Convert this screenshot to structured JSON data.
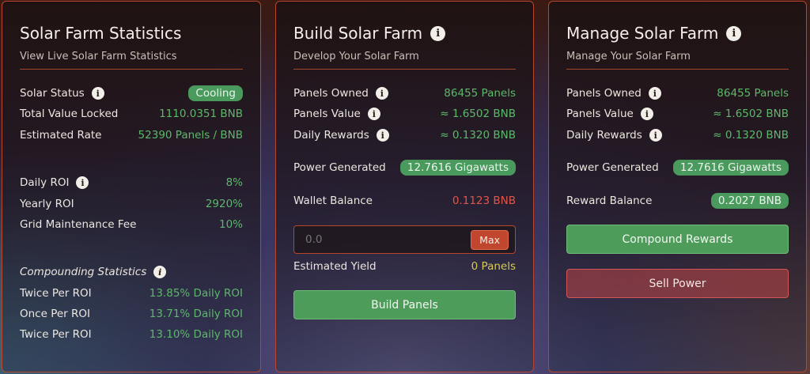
{
  "stats": {
    "title": "Solar Farm Statistics",
    "subtitle": "View Live Solar Farm Statistics",
    "solar_status_label": "Solar Status",
    "solar_status_value": "Cooling",
    "tvl_label": "Total Value Locked",
    "tvl_value": "1110.0351 BNB",
    "rate_label": "Estimated Rate",
    "rate_value": "52390 Panels / BNB",
    "daily_roi_label": "Daily ROI",
    "daily_roi_value": "8%",
    "yearly_roi_label": "Yearly ROI",
    "yearly_roi_value": "2920%",
    "fee_label": "Grid Maintenance Fee",
    "fee_value": "10%",
    "compounding_label": "Compounding Statistics",
    "compound_rows": [
      {
        "label": "Twice Per ROI",
        "value": "13.85% Daily ROI"
      },
      {
        "label": "Once Per ROI",
        "value": "13.71% Daily ROI"
      },
      {
        "label": "Twice Per ROI",
        "value": "13.10% Daily ROI"
      }
    ]
  },
  "build": {
    "title": "Build Solar Farm",
    "subtitle": "Develop Your Solar Farm",
    "panels_owned_label": "Panels Owned",
    "panels_owned_value": "86455 Panels",
    "panels_value_label": "Panels Value",
    "panels_value_value": "≈ 1.6502 BNB",
    "daily_rewards_label": "Daily Rewards",
    "daily_rewards_value": "≈ 0.1320 BNB",
    "power_label": "Power Generated",
    "power_value": "12.7616 Gigawatts",
    "wallet_label": "Wallet Balance",
    "wallet_value": "0.1123 BNB",
    "input_placeholder": "0.0",
    "max_label": "Max",
    "yield_label": "Estimated Yield",
    "yield_value": "0 Panels",
    "build_button": "Build Panels"
  },
  "manage": {
    "title": "Manage Solar Farm",
    "subtitle": "Manage Your Solar Farm",
    "panels_owned_label": "Panels Owned",
    "panels_owned_value": "86455 Panels",
    "panels_value_label": "Panels Value",
    "panels_value_value": "≈ 1.6502 BNB",
    "daily_rewards_label": "Daily Rewards",
    "daily_rewards_value": "≈ 0.1320 BNB",
    "power_label": "Power Generated",
    "power_value": "12.7616 Gigawatts",
    "reward_label": "Reward Balance",
    "reward_value": "0.2027 BNB",
    "compound_button": "Compound Rewards",
    "sell_button": "Sell Power"
  },
  "colors": {
    "accent_border": "#b8462c",
    "positive": "#5cb86a",
    "negative": "#e05548",
    "yield": "#d6c95a",
    "pill": "#4a9a5e"
  }
}
